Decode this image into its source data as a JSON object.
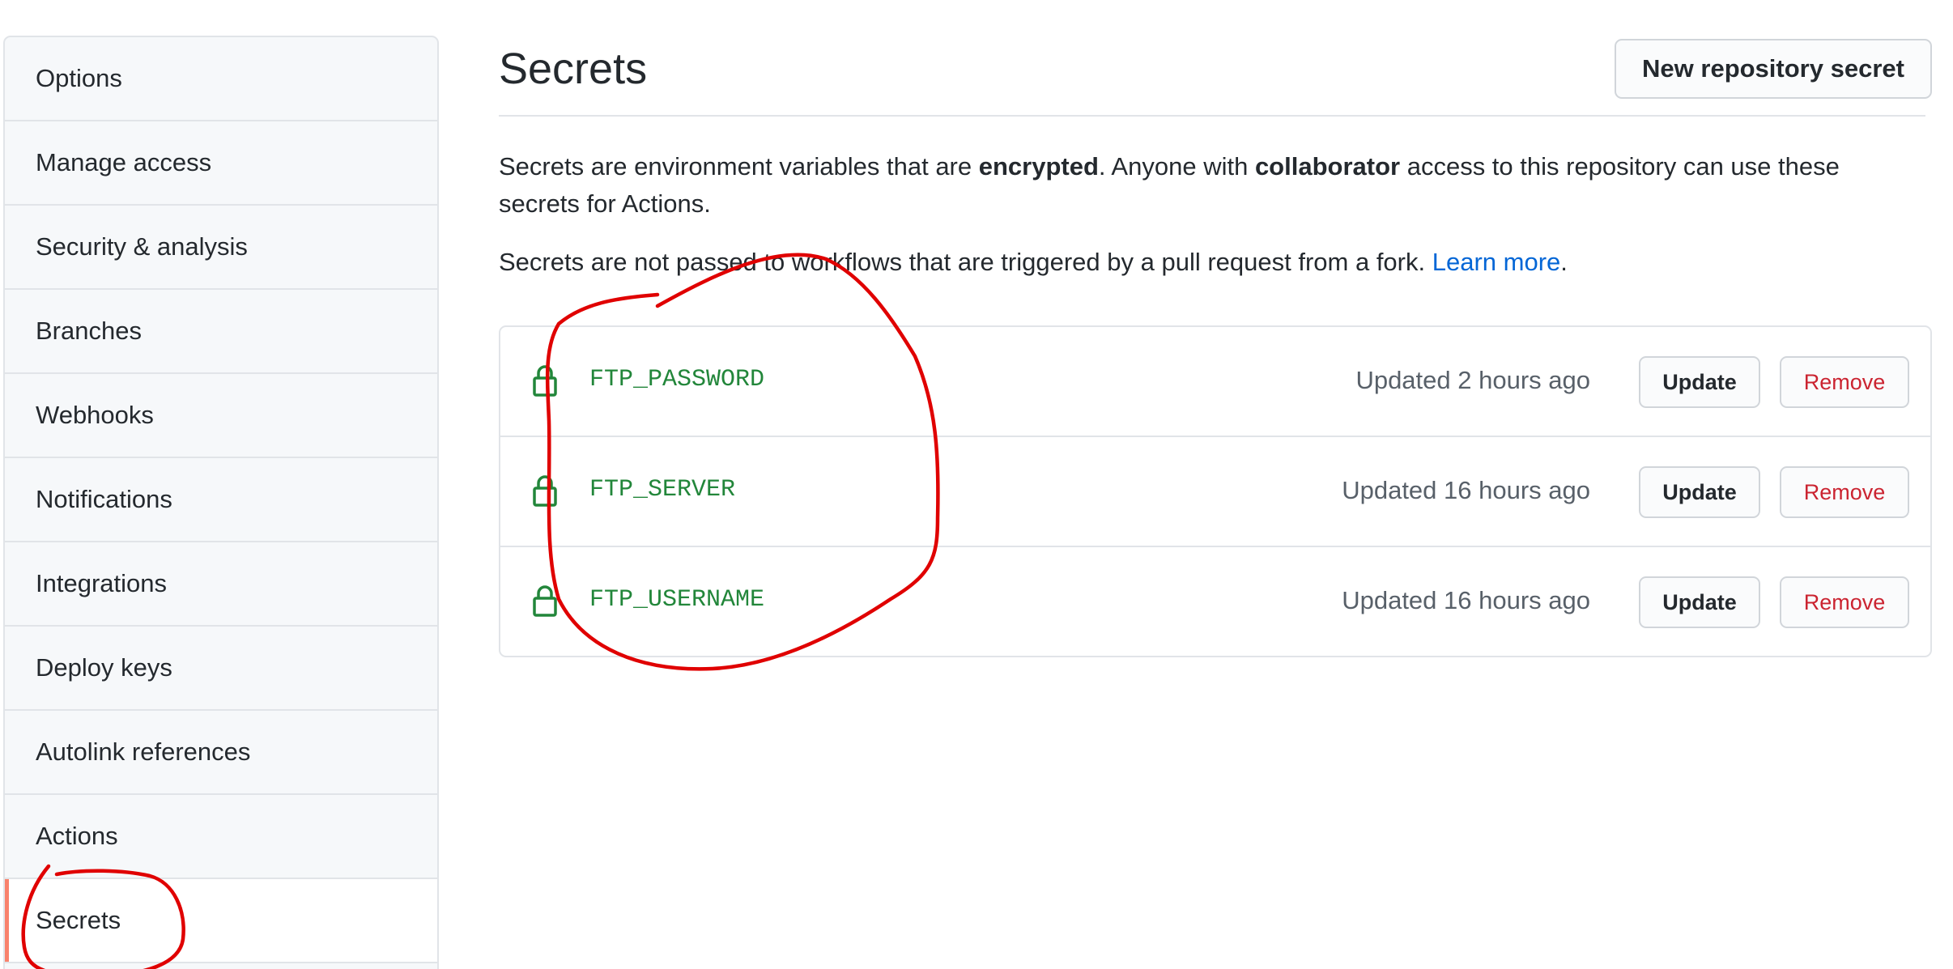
{
  "sidebar": {
    "items": [
      {
        "label": "Options"
      },
      {
        "label": "Manage access"
      },
      {
        "label": "Security & analysis"
      },
      {
        "label": "Branches"
      },
      {
        "label": "Webhooks"
      },
      {
        "label": "Notifications"
      },
      {
        "label": "Integrations"
      },
      {
        "label": "Deploy keys"
      },
      {
        "label": "Autolink references"
      },
      {
        "label": "Actions"
      },
      {
        "label": "Secrets",
        "selected": true
      }
    ]
  },
  "header": {
    "title": "Secrets",
    "new_secret_label": "New repository secret"
  },
  "description": {
    "p1_part1": "Secrets are environment variables that are ",
    "p1_bold1": "encrypted",
    "p1_part2": ". Anyone with ",
    "p1_bold2": "collaborator",
    "p1_part3": " access to this repository can use these secrets for Actions.",
    "p2_text": "Secrets are not passed to workflows that are triggered by a pull request from a fork. ",
    "p2_link": "Learn more",
    "p2_end": "."
  },
  "secrets": [
    {
      "name": "FTP_PASSWORD",
      "updated": "Updated 2 hours ago",
      "update_label": "Update",
      "remove_label": "Remove"
    },
    {
      "name": "FTP_SERVER",
      "updated": "Updated 16 hours ago",
      "update_label": "Update",
      "remove_label": "Remove"
    },
    {
      "name": "FTP_USERNAME",
      "updated": "Updated 16 hours ago",
      "update_label": "Update",
      "remove_label": "Remove"
    }
  ],
  "colors": {
    "accent_selected": "#f9826c",
    "secret_name": "#22863a",
    "link": "#0366d6",
    "danger": "#cb2431",
    "annotation": "#e00000"
  },
  "icons": {
    "secret_icon": "lock-icon"
  }
}
